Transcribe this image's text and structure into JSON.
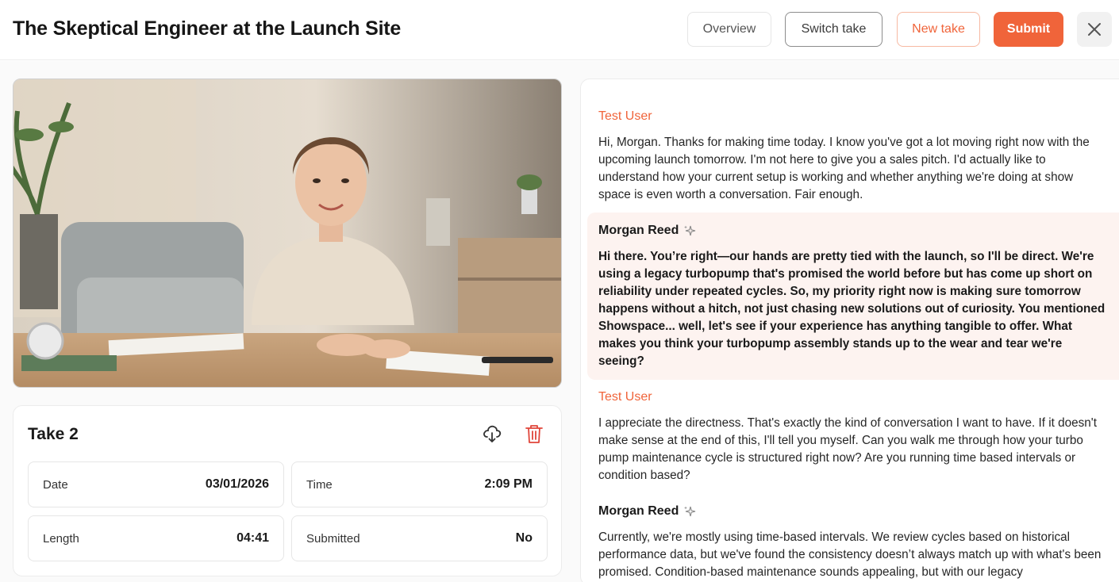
{
  "header": {
    "title": "The Skeptical Engineer at the Launch Site",
    "overview_label": "Overview",
    "switch_label": "Switch take",
    "new_take_label": "New take",
    "submit_label": "Submit",
    "close_icon": "close-icon"
  },
  "take": {
    "title": "Take 2",
    "download_icon": "cloud-download-icon",
    "delete_icon": "trash-icon",
    "stats": {
      "date_label": "Date",
      "date_value": "03/01/2026",
      "time_label": "Time",
      "time_value": "2:09 PM",
      "length_label": "Length",
      "length_value": "04:41",
      "submitted_label": "Submitted",
      "submitted_value": "No"
    }
  },
  "transcript": {
    "messages": [
      {
        "speaker": "Test User",
        "text": "Hi, Morgan. Thanks for making time today. I know you've got a lot moving right now with the upcoming launch tomorrow. I'm not here to give you a sales pitch. I'd actually like to understand how your current setup is working and whether anything we're doing at show space is even worth a conversation. Fair enough."
      },
      {
        "speaker": "Morgan Reed",
        "text": "Hi there. You’re right—our hands are pretty tied with the launch, so I'll be direct. We're using a legacy turbopump that's promised the world before but has come up short on reliability under repeated cycles. So, my priority right now is making sure tomorrow happens without a hitch, not just chasing new solutions out of curiosity. You mentioned Showspace... well, let's see if your experience has anything tangible to offer. What makes you think your turbopump assembly stands up to the wear and tear we're seeing?"
      },
      {
        "speaker": "Test User",
        "text": "I appreciate the directness. That's exactly the kind of conversation I want to have. If it doesn't make sense at the end of this, I'll tell you myself. Can you walk me through how your turbo pump maintenance cycle is structured right now? Are you running time based intervals or condition based?"
      },
      {
        "speaker": "Morgan Reed",
        "text": "Currently, we're mostly using time-based intervals. We review cycles based on historical performance data, but we've found the consistency doesn’t always match up with what's been promised. Condition-based maintenance sounds appealing, but with our legacy"
      }
    ],
    "sparkle_icon": "sparkle-icon"
  },
  "colors": {
    "accent": "#f0643a",
    "highlight_bg": "#fdf3f0"
  }
}
